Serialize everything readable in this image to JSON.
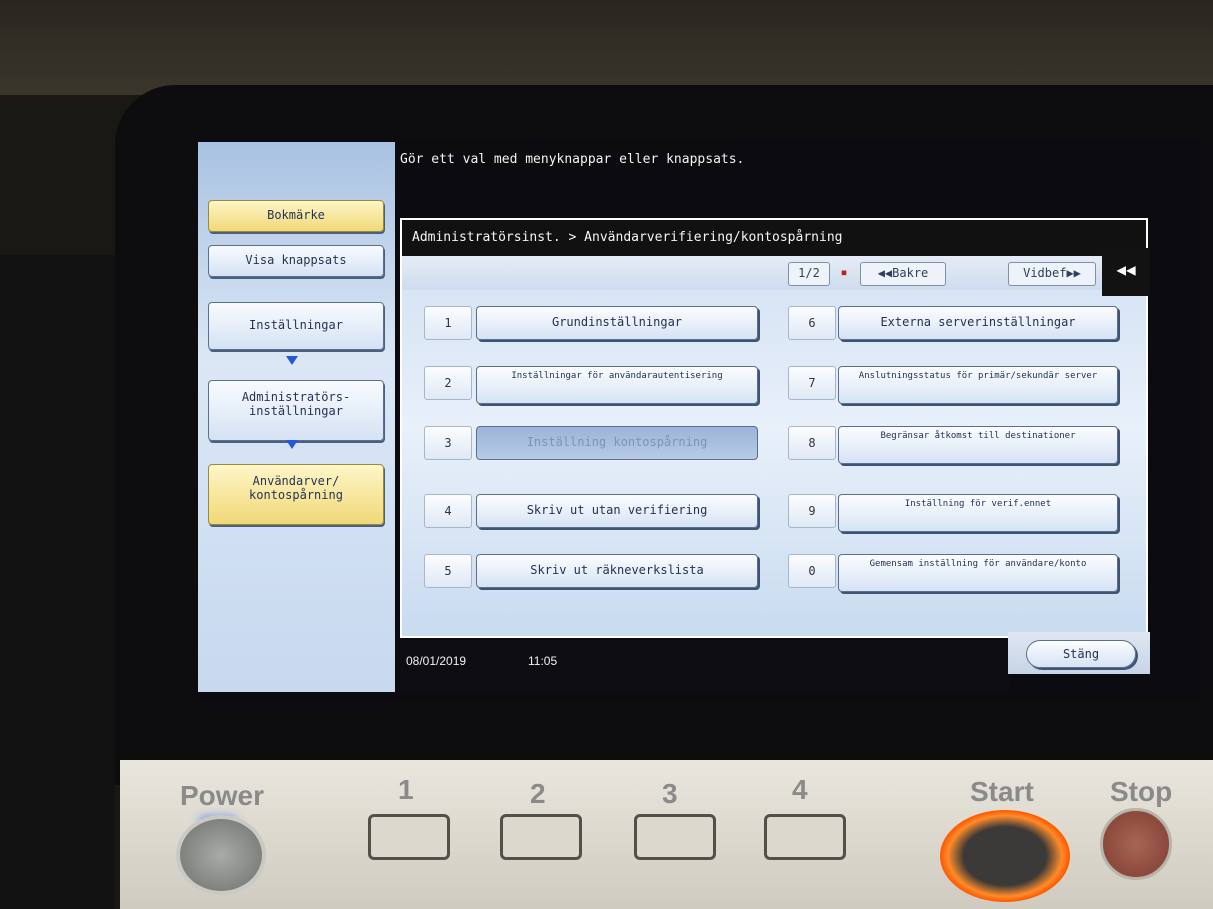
{
  "instruction": "Gör ett val med menyknappar eller knappsats.",
  "sidebar": {
    "bookmark": "Bokmärke",
    "show_keypad": "Visa knappsats",
    "settings": "Inställningar",
    "admin_settings": "Administratörs-\ninställningar",
    "user_auth": "Användarver/\nkontospårning"
  },
  "header": {
    "breadcrumb": "Administratörsinst. > Användarverifiering/kontospårning"
  },
  "paging": {
    "page": "1/2",
    "prev": "◀◀Bakre",
    "next": "Vidbef▶▶"
  },
  "menu": [
    {
      "num": "1",
      "label": "Grundinställningar"
    },
    {
      "num": "2",
      "label": "Inställningar för användarautentisering"
    },
    {
      "num": "3",
      "label": "Inställning kontospårning"
    },
    {
      "num": "4",
      "label": "Skriv ut utan verifiering"
    },
    {
      "num": "5",
      "label": "Skriv ut räkneverkslista"
    },
    {
      "num": "6",
      "label": "Externa serverinställningar"
    },
    {
      "num": "7",
      "label": "Anslutningsstatus för primär/sekundär server"
    },
    {
      "num": "8",
      "label": "Begränsar åtkomst till destinationer"
    },
    {
      "num": "9",
      "label": "Inställning för verif.ennet"
    },
    {
      "num": "0",
      "label": "Gemensam inställning för användare/konto"
    }
  ],
  "status": {
    "date": "08/01/2019",
    "time": "11:05"
  },
  "close_label": "Stäng",
  "collapse_label": "◀◀",
  "hardware": {
    "power": "Power",
    "key1": "1",
    "key2": "2",
    "key3": "3",
    "key4": "4",
    "start": "Start",
    "stop": "Stop"
  },
  "colors": {
    "accent_blue": "#2458d6",
    "bookmark_yellow": "#f0d877",
    "start_glow": "#ff7a1a"
  }
}
